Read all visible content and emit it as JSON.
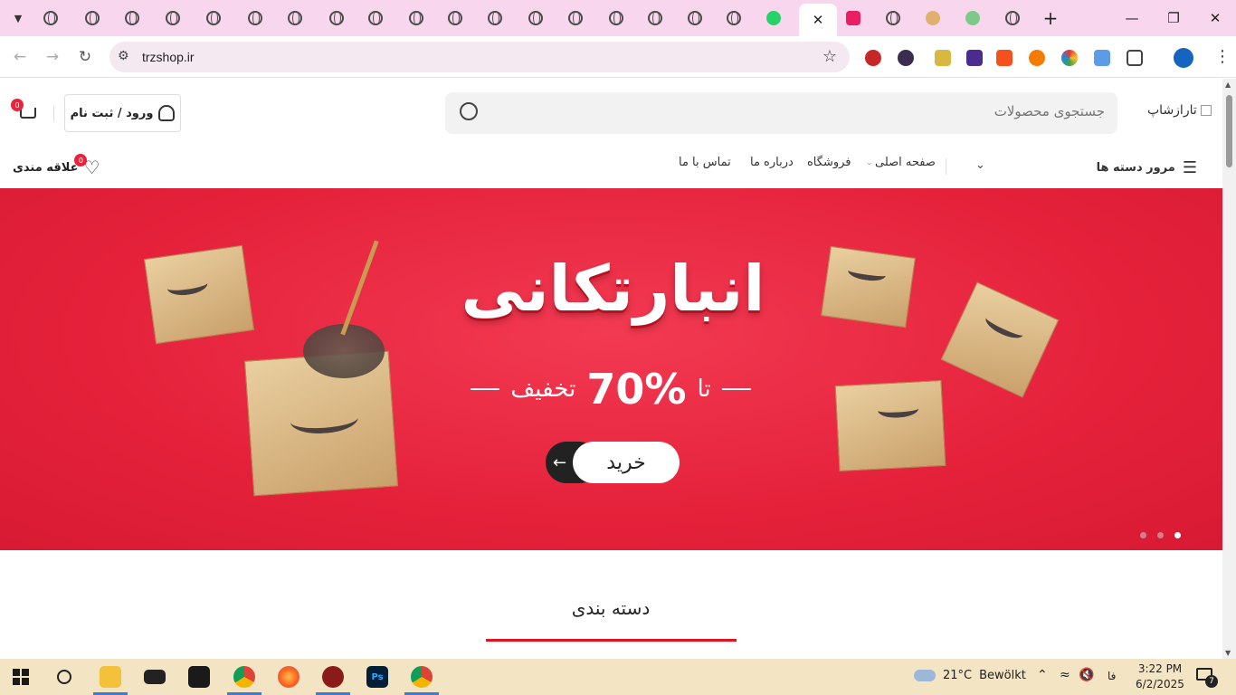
{
  "browser": {
    "url": "trzshop.ir",
    "tab_count_generic": 18
  },
  "header": {
    "logo_alt": "تارازشاپ",
    "search_placeholder": "جستجوی محصولات",
    "login_label": "ورود / ثبت نام",
    "cart_count": "0",
    "wishlist_label": "علاقه مندی",
    "wishlist_count": "0"
  },
  "nav": {
    "categories_label": "مرور دسته ها",
    "items": [
      "صفحه اصلی",
      "فروشگاه",
      "درباره ما",
      "تماس با ما"
    ]
  },
  "hero": {
    "title": "انبارتکانی",
    "subtitle_prefix": "تا",
    "subtitle_percent": "70%",
    "subtitle_suffix": "تخفیف",
    "buy_label": "خرید",
    "slide_count": 3,
    "active_slide": 1
  },
  "section": {
    "categories_title": "دسته بندی"
  },
  "taskbar": {
    "weather_temp": "21°C",
    "weather_text": "Bewölkt",
    "lang": "فا",
    "time": "3:22 PM",
    "date": "6/2/2025",
    "notif_count": "7"
  },
  "colors": {
    "tabbar": "#f7d6ee",
    "hero_red": "#e5213a",
    "accent_line": "#e1141f",
    "taskbar": "#f3e4c4"
  }
}
